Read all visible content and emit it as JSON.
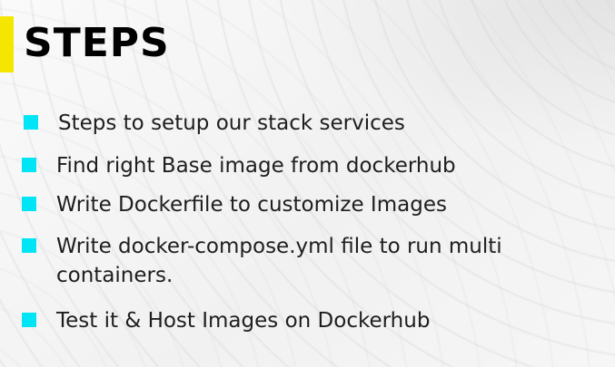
{
  "slide": {
    "title": "STEPS",
    "accent_color": "#f5e600",
    "bullet_color": "#00e5f5",
    "steps": [
      "Steps to setup our stack services",
      "Find right Base image from dockerhub",
      "Write Dockerfile to customize Images",
      "Write docker-compose.yml file to run multi containers.",
      "Test it & Host Images on Dockerhub"
    ]
  }
}
